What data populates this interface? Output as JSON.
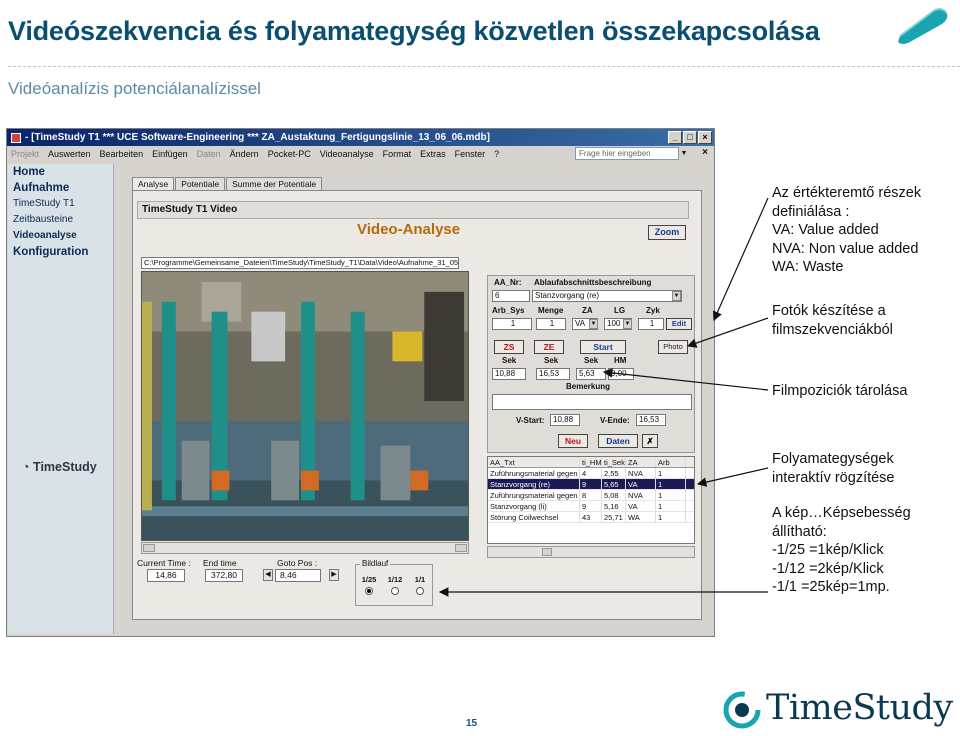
{
  "slide": {
    "title": "Videószekvencia és folyamategység közvetlen összekapcsolása",
    "subtitle": "Videóanalízis potenciálanalízissel",
    "page_number": "15",
    "brand": "TimeStudy"
  },
  "colors": {
    "title": "#0a4f72",
    "subtitle": "#5a8aa6",
    "accent_orange": "#b86a0a",
    "window_title": "#0a246a",
    "selected_row": "#1a1a55"
  },
  "window": {
    "title": "- [TimeStudy T1     *** UCE Software-Engineering ***     ZA_Austaktung_Fertigungslinie_13_06_06.mdb]",
    "menu": [
      "Projekt",
      "Auswerten",
      "Bearbeiten",
      "Einfügen",
      "Daten",
      "Ändern",
      "Pocket-PC",
      "Videoanalyse",
      "Format",
      "Extras",
      "Fenster",
      "?"
    ],
    "help_placeholder": "Frage hier eingeben",
    "sidebar": {
      "items": [
        "Home",
        "Aufnahme",
        "TimeStudy T1",
        "Zeitbausteine",
        "Videoanalyse",
        "Konfiguration"
      ],
      "logo": "TimeStudy"
    },
    "tabs": [
      "Analyse",
      "Potentiale",
      "Summe der Potentiale"
    ],
    "form_title": "TimeStudy T1 Video",
    "video_title": "Video-Analyse",
    "zoom_label": "Zoom",
    "video_path": "C:\\Programme\\Gemeinsame_Dateien\\TimeStudy\\TimeStudy_T1\\Data\\Video\\Aufnahme_31_05_06_0001.wmv",
    "bottom": {
      "current_time_label": "Current Time :",
      "current_time": "14,86",
      "end_time_label": "End time",
      "end_time": "372,80",
      "goto_label": "Goto Pos :",
      "goto_value": "8,46",
      "bildlauf_label": "Bildlauf",
      "bildlauf_options": [
        "1/25",
        "1/12",
        "1/1"
      ],
      "bildlauf_selected": "1/25"
    },
    "right_panel": {
      "aa_nr_label": "AA_Nr:",
      "aa_nr": "6",
      "desc_label": "Ablaufabschnittsbeschreibung",
      "desc": "Stanzvorgang (re)",
      "arb_sys_label": "Arb_Sys",
      "arb_sys": "1",
      "menge_label": "Menge",
      "menge": "1",
      "za_label": "ZA",
      "za": "VA",
      "lg_label": "LG",
      "lg": "100",
      "zyk_label": "Zyk",
      "zyk": "1",
      "edit_label": "Edit",
      "zs_label": "ZS",
      "ze_label": "ZE",
      "start_label": "Start",
      "photo_label": "Photo",
      "sek1_label": "Sek",
      "sek1": "10,88",
      "sek2_label": "Sek",
      "sek2": "16,53",
      "sek3_label": "Sek",
      "sek3": "5,63",
      "hm_label": "HM",
      "hm": "9,00",
      "bemerkung_label": "Bemerkung",
      "vstart_label": "V-Start:",
      "vstart": "10,88",
      "vende_label": "V-Ende:",
      "vende": "16,53",
      "neu_label": "Neu",
      "daten_label": "Daten"
    },
    "grid": {
      "columns": [
        "AA_Txt",
        "ti_HM",
        "ti_Sek",
        "ZA",
        "Arb"
      ],
      "rows": [
        [
          "Zuführungsmaterial gegen r",
          "4",
          "2,55",
          "NVA",
          "1"
        ],
        [
          "Stanzvorgang (re)",
          "9",
          "5,65",
          "VA",
          "1"
        ],
        [
          "Zuführungsmaterial gegen r",
          "8",
          "5,08",
          "NVA",
          "1"
        ],
        [
          "Stanzvorgang (li)",
          "9",
          "5,16",
          "VA",
          "1"
        ],
        [
          "Störung Coilwechsel",
          "43",
          "25,71",
          "WA",
          "1"
        ]
      ],
      "selected_row": 1
    }
  },
  "annotations": [
    [
      "Az értékteremtő részek",
      "definiálása :",
      "VA:   Value added",
      "NVA: Non value added",
      "WA:  Waste"
    ],
    [
      "Fotók készítése a",
      "filmszekvenciákból"
    ],
    [
      "Filmpoziciók tárolása"
    ],
    [
      "Folyamategységek",
      "interaktív rögzítése"
    ],
    [
      "A kép…Képsebesség",
      " állítható:",
      "-1/25 =1kép/Klick",
      "-1/12 =2kép/Klick",
      "-1/1   =25kép=1mp."
    ]
  ]
}
